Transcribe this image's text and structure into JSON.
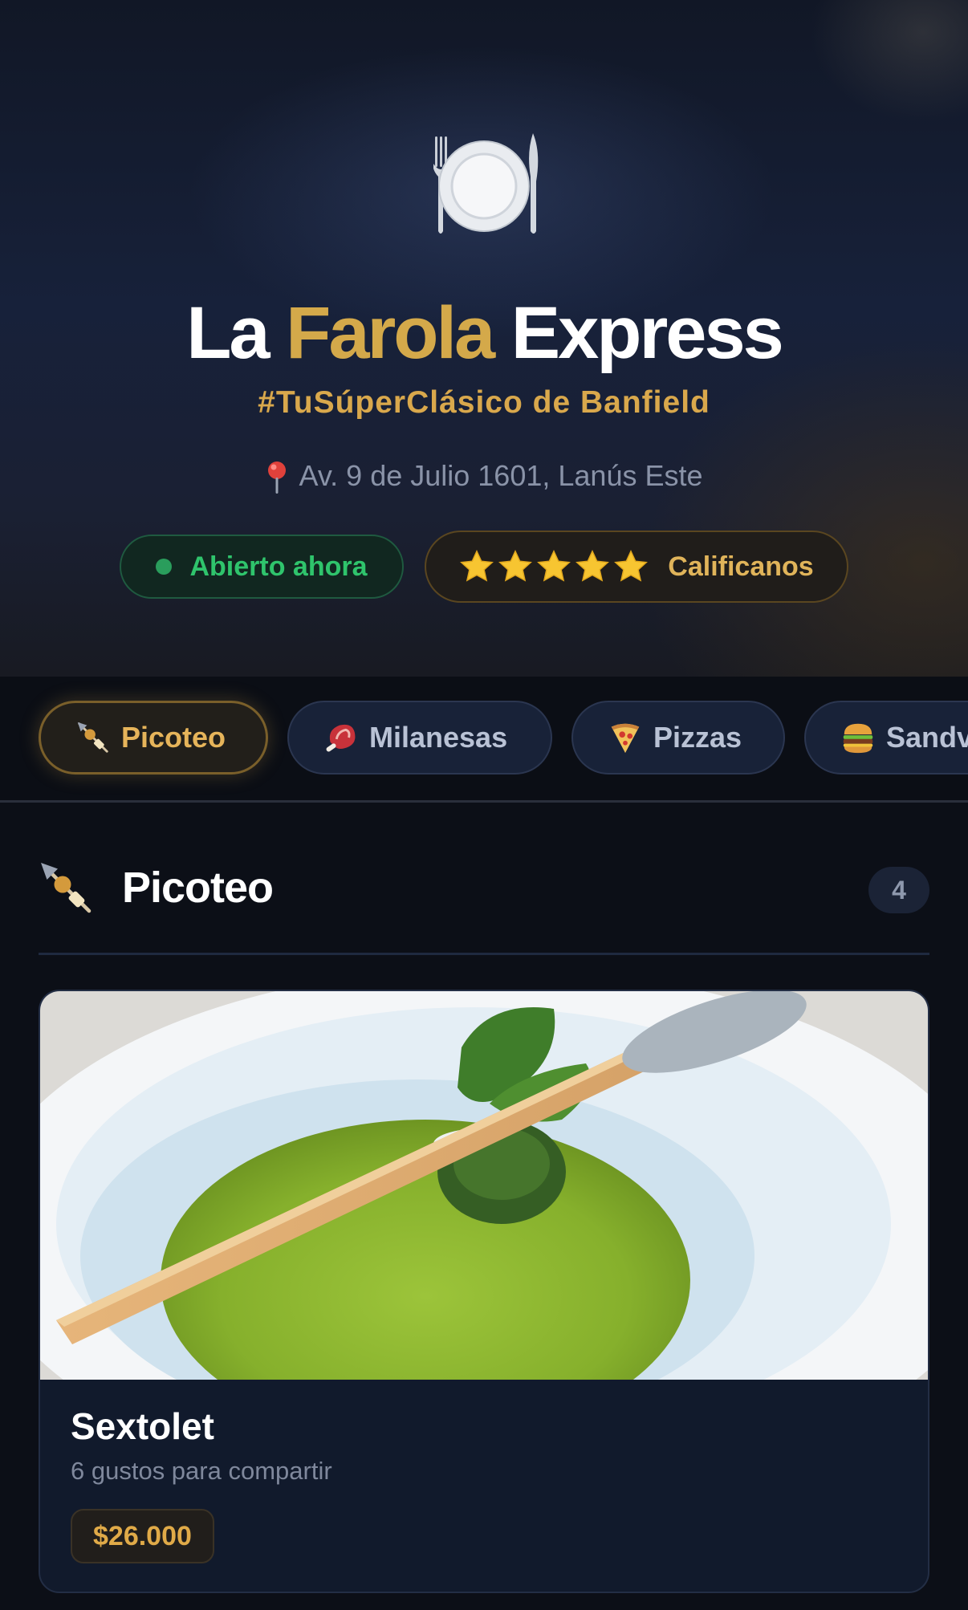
{
  "header": {
    "icon": "plate-with-cutlery-icon",
    "title_part1": "La",
    "title_part2": "Farola",
    "title_part3": "Express",
    "tagline": "#TuSúperClásico de Banfield",
    "address": "Av. 9 de Julio 1601, Lanús Este",
    "status_label": "Abierto ahora",
    "status_color": "#2fc46c",
    "rating_label": "Calificanos",
    "rating_stars": 5,
    "accent_color": "#d4a94a"
  },
  "categories": [
    {
      "label": "Picoteo",
      "icon": "skewer-icon",
      "active": true
    },
    {
      "label": "Milanesas",
      "icon": "meat-icon",
      "active": false
    },
    {
      "label": "Pizzas",
      "icon": "pizza-icon",
      "active": false
    },
    {
      "label": "Sandv",
      "icon": "burger-icon",
      "active": false
    }
  ],
  "section": {
    "icon": "skewer-icon",
    "title": "Picoteo",
    "count": "4"
  },
  "products": [
    {
      "name": "Sextolet",
      "description": "6 gustos para compartir",
      "price": "$26.000",
      "image": "green-soup-with-breadstick"
    }
  ]
}
